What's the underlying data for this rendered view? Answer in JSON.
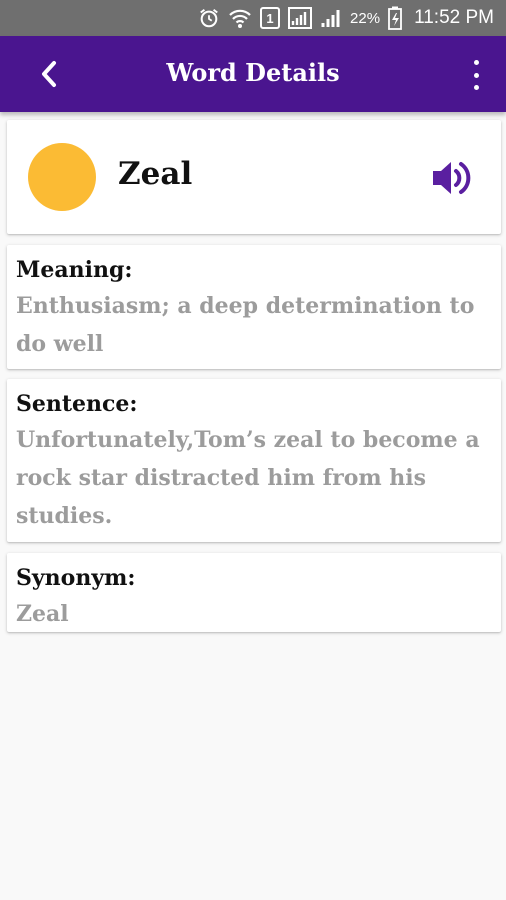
{
  "status_bar": {
    "sim": "1",
    "battery": "22%",
    "time": "11:52 PM",
    "icons": [
      "alarm-icon",
      "wifi-icon",
      "sim-icon",
      "signal-icon",
      "signal-icon",
      "battery-icon"
    ]
  },
  "app_bar": {
    "title": "Word Details",
    "back_icon": "chevron-left-icon",
    "menu_icon": "overflow-menu-icon"
  },
  "word": {
    "text": "Zeal",
    "avatar_color": "#fbbb34",
    "speaker_icon": "speaker-icon"
  },
  "meaning": {
    "label": "Meaning:",
    "value": "Enthusiasm; a deep determination to do well"
  },
  "sentence": {
    "label": "Sentence:",
    "value": "Unfortunately,Tom’s zeal to become a rock star distracted him from his studies."
  },
  "synonym": {
    "label": "Synonym:",
    "value": "Zeal"
  },
  "colors": {
    "app_bar": "#4a158f",
    "accent": "#5a1fa0",
    "status_bar": "#6f6f6f",
    "background": "#f9f9f9"
  }
}
